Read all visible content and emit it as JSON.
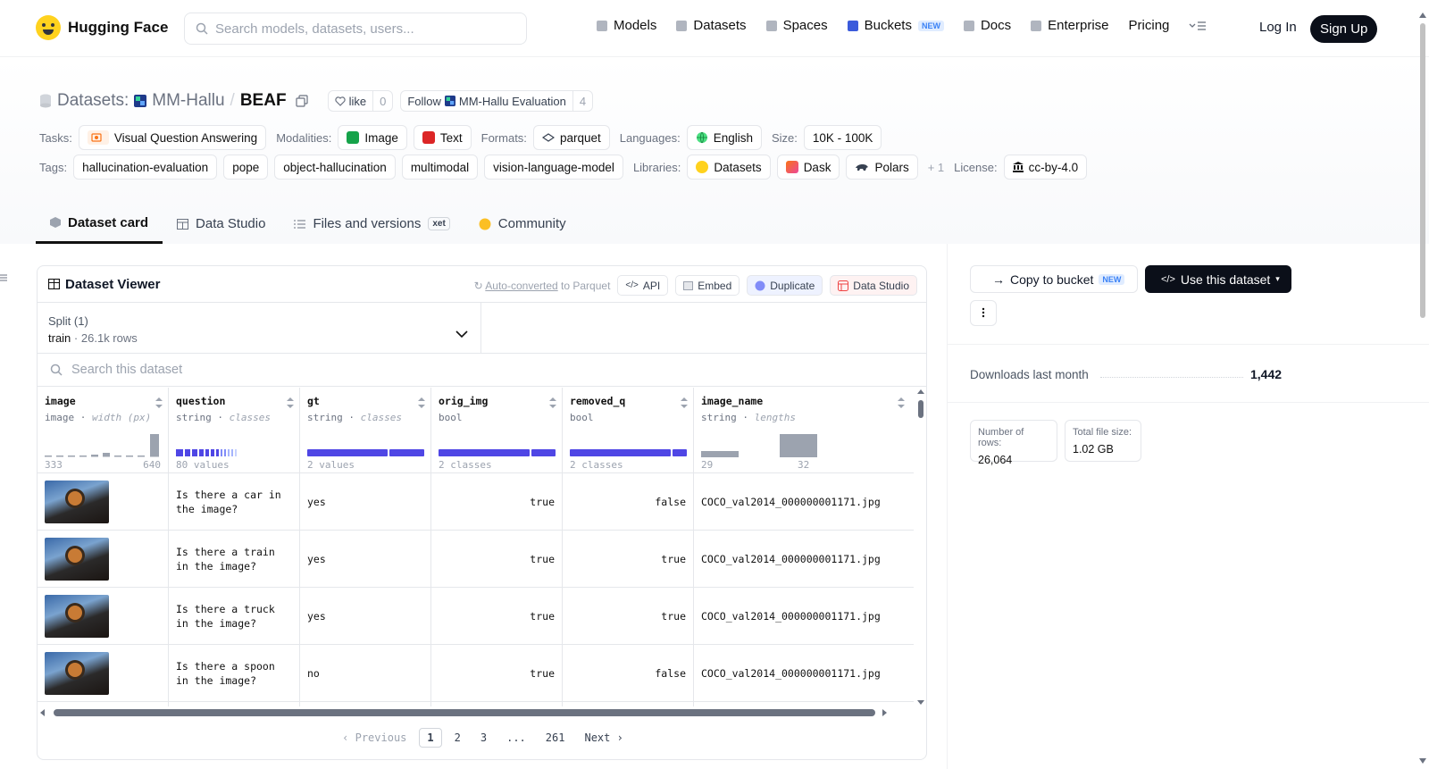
{
  "nav": {
    "logo_text": "Hugging Face",
    "search_placeholder": "Search models, datasets, users...",
    "links": [
      "Models",
      "Datasets",
      "Spaces",
      "Buckets",
      "Docs",
      "Enterprise",
      "Pricing"
    ],
    "buckets_badge": "NEW",
    "login": "Log In",
    "signup": "Sign Up"
  },
  "header": {
    "prefix": "Datasets:",
    "org": "MM-Hallu",
    "slash": "/",
    "name": "BEAF",
    "like_label": "like",
    "like_count": "0",
    "follow_label": "Follow",
    "follow_org": "MM-Hallu Evaluation",
    "follow_count": "4",
    "tasks_label": "Tasks:",
    "task": "Visual Question Answering",
    "modalities_label": "Modalities:",
    "modalities": [
      "Image",
      "Text"
    ],
    "formats_label": "Formats:",
    "format": "parquet",
    "languages_label": "Languages:",
    "language": "English",
    "size_label": "Size:",
    "size": "10K - 100K",
    "tags_label": "Tags:",
    "tags": [
      "hallucination-evaluation",
      "pope",
      "object-hallucination",
      "multimodal",
      "vision-language-model"
    ],
    "libraries_label": "Libraries:",
    "libraries": [
      "Datasets",
      "Dask",
      "Polars"
    ],
    "libraries_more": "+ 1",
    "license_label": "License:",
    "license": "cc-by-4.0"
  },
  "tabs": {
    "card": "Dataset card",
    "studio": "Data Studio",
    "files": "Files and versions",
    "xet": "xet",
    "community": "Community"
  },
  "viewer": {
    "title": "Dataset Viewer",
    "auto_link": "Auto-converted",
    "auto_rest": "to Parquet",
    "api": "API",
    "embed": "Embed",
    "duplicate": "Duplicate",
    "data_studio": "Data Studio",
    "split_label": "Split (1)",
    "split_name": "train",
    "split_dot": "·",
    "split_rows": "26.1k rows",
    "search_placeholder": "Search this dataset",
    "columns": [
      {
        "name": "image",
        "type": "image",
        "sub": "width (px)",
        "foot_left": "333",
        "foot_right": "640"
      },
      {
        "name": "question",
        "type": "string",
        "sub": "classes",
        "foot_left": "80 values",
        "foot_right": ""
      },
      {
        "name": "gt",
        "type": "string",
        "sub": "classes",
        "foot_left": "2 values",
        "foot_right": ""
      },
      {
        "name": "orig_img",
        "type": "bool",
        "sub": "",
        "foot_left": "2 classes",
        "foot_right": ""
      },
      {
        "name": "removed_q",
        "type": "bool",
        "sub": "",
        "foot_left": "2 classes",
        "foot_right": ""
      },
      {
        "name": "image_name",
        "type": "string",
        "sub": "lengths",
        "foot_left": "29",
        "foot_right": "32"
      }
    ],
    "rows": [
      {
        "question": "Is there a car in the image?",
        "gt": "yes",
        "orig_img": "true",
        "removed_q": "false",
        "image_name": "COCO_val2014_000000001171.jpg"
      },
      {
        "question": "Is there a train in the image?",
        "gt": "yes",
        "orig_img": "true",
        "removed_q": "true",
        "image_name": "COCO_val2014_000000001171.jpg"
      },
      {
        "question": "Is there a truck in the image?",
        "gt": "yes",
        "orig_img": "true",
        "removed_q": "true",
        "image_name": "COCO_val2014_000000001171.jpg"
      },
      {
        "question": "Is there a spoon in the image?",
        "gt": "no",
        "orig_img": "true",
        "removed_q": "false",
        "image_name": "COCO_val2014_000000001171.jpg"
      }
    ],
    "pager": {
      "prev": "Previous",
      "pages": [
        "1",
        "2",
        "3",
        "...",
        "261"
      ],
      "next": "Next"
    }
  },
  "sidebar": {
    "copy": "Copy to bucket",
    "copy_badge": "NEW",
    "use": "Use this dataset",
    "downloads_label": "Downloads last month",
    "downloads": "1,442",
    "rows_label": "Number of rows:",
    "rows_value": "26,064",
    "size_label": "Total file size:",
    "size_value": "1.02 GB"
  },
  "colors": {
    "accent": "#4f46e5",
    "dark": "#0b0f19",
    "hf_yellow": "#ffd21e"
  }
}
